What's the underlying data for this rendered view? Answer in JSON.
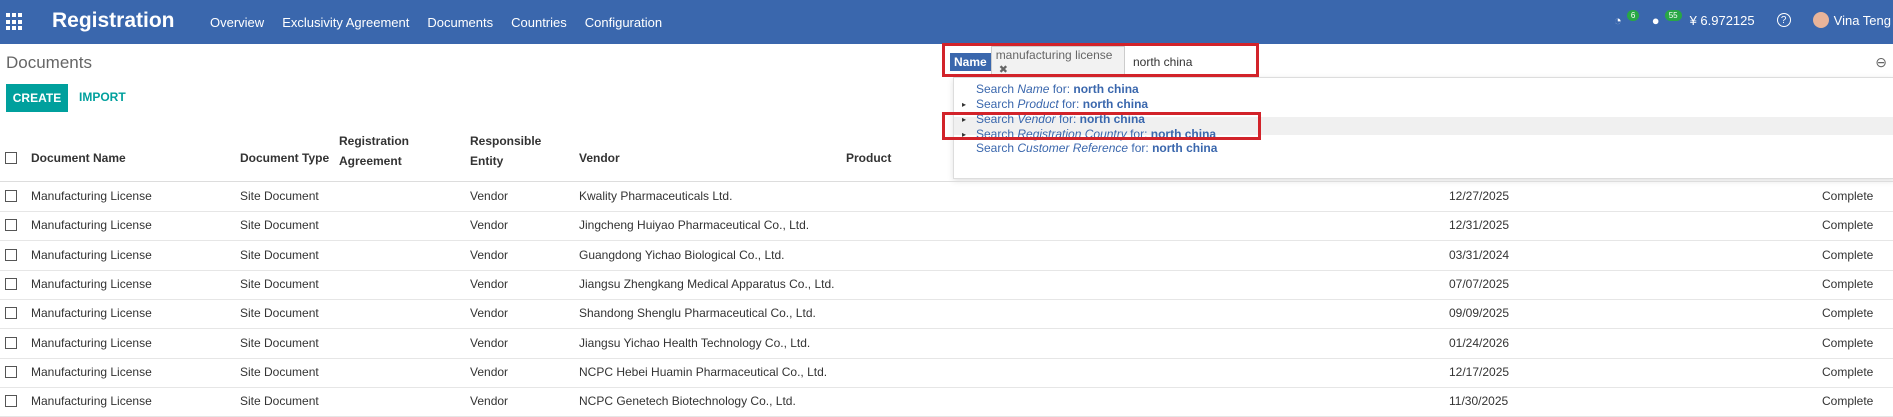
{
  "topbar": {
    "brand": "Registration",
    "menu": [
      "Overview",
      "Exclusivity Agreement",
      "Documents",
      "Countries",
      "Configuration"
    ],
    "activity_count": "6",
    "message_count": "55",
    "currency": "¥ 6.972125",
    "help": "?",
    "user": "Vina Teng"
  },
  "page": {
    "title": "Documents",
    "create_label": "CREATE",
    "import_label": "IMPORT"
  },
  "search": {
    "facet_name": "Name",
    "facet_value": "manufacturing license",
    "facet_remove": "✖",
    "input_value": "north china",
    "suggestions": [
      {
        "prefix": "Search ",
        "field": "Name",
        "middle": " for: ",
        "term": "north china"
      },
      {
        "prefix": "Search ",
        "field": "Product",
        "middle": " for: ",
        "term": "north china"
      },
      {
        "prefix": "Search ",
        "field": "Vendor",
        "middle": " for: ",
        "term": "north china"
      },
      {
        "prefix": "Search ",
        "field": "Registration Country",
        "middle": " for: ",
        "term": "north china"
      },
      {
        "prefix": "Search ",
        "field": "Customer Reference",
        "middle": " for: ",
        "term": "north china"
      }
    ]
  },
  "table": {
    "headers": {
      "document_name": "Document Name",
      "document_type": "Document Type",
      "registration_agreement_1": "Registration",
      "registration_agreement_2": "Agreement",
      "responsible_entity_1": "Responsible",
      "responsible_entity_2": "Entity",
      "vendor": "Vendor",
      "product": "Product"
    },
    "rows": [
      {
        "name": "Manufacturing License",
        "type": "Site Document",
        "entity": "Vendor",
        "vendor": "Kwality Pharmaceuticals Ltd.",
        "date": "12/27/2025",
        "status": "Complete"
      },
      {
        "name": "Manufacturing License",
        "type": "Site Document",
        "entity": "Vendor",
        "vendor": "Jingcheng Huiyao Pharmaceutical Co., Ltd.",
        "date": "12/31/2025",
        "status": "Complete"
      },
      {
        "name": "Manufacturing License",
        "type": "Site Document",
        "entity": "Vendor",
        "vendor": "Guangdong Yichao Biological Co., Ltd.",
        "date": "03/31/2024",
        "status": "Complete"
      },
      {
        "name": "Manufacturing License",
        "type": "Site Document",
        "entity": "Vendor",
        "vendor": "Jiangsu Zhengkang Medical Apparatus Co., Ltd.",
        "date": "07/07/2025",
        "status": "Complete"
      },
      {
        "name": "Manufacturing License",
        "type": "Site Document",
        "entity": "Vendor",
        "vendor": "Shandong Shenglu Pharmaceutical Co., Ltd.",
        "date": "09/09/2025",
        "status": "Complete"
      },
      {
        "name": "Manufacturing License",
        "type": "Site Document",
        "entity": "Vendor",
        "vendor": "Jiangsu Yichao Health Technology Co., Ltd.",
        "date": "01/24/2026",
        "status": "Complete"
      },
      {
        "name": "Manufacturing License",
        "type": "Site Document",
        "entity": "Vendor",
        "vendor": "NCPC Hebei Huamin Pharmaceutical Co., Ltd.",
        "date": "12/17/2025",
        "status": "Complete"
      },
      {
        "name": "Manufacturing License",
        "type": "Site Document",
        "entity": "Vendor",
        "vendor": "NCPC Genetech Biotechnology Co., Ltd.",
        "date": "11/30/2025",
        "status": "Complete"
      }
    ]
  },
  "colors": {
    "navbar": "#3a67ad",
    "accent": "#00a09d",
    "highlight_box": "#d2232a"
  }
}
